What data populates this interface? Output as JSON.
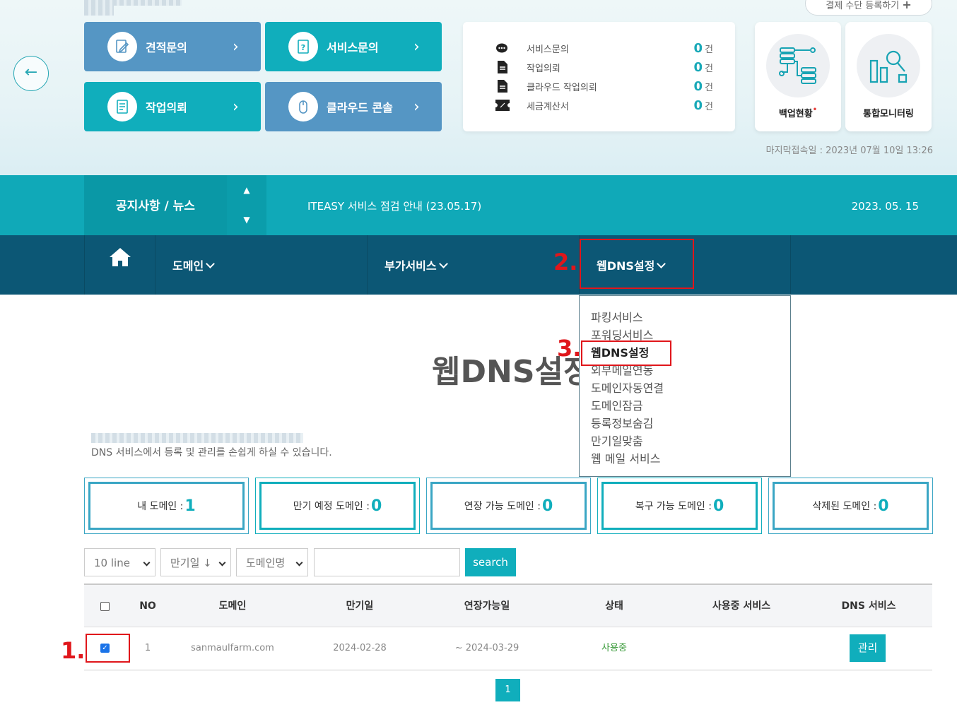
{
  "header": {
    "pay_register": "결제 수단 등록하기",
    "pay_plus": "+",
    "back_arrow": "←",
    "quick_buttons": [
      {
        "label": "견적문의",
        "icon": "edit-doc-icon",
        "color": "#5596c4"
      },
      {
        "label": "서비스문의",
        "icon": "question-doc-icon",
        "color": "#10aebc"
      },
      {
        "label": "작업의뢰",
        "icon": "list-doc-icon",
        "color": "#10aebc"
      },
      {
        "label": "클라우드 콘솔",
        "icon": "mouse-icon",
        "color": "#5596c4"
      }
    ],
    "chevron": "›",
    "stats": [
      {
        "label": "서비스문의",
        "value": "0",
        "unit": "건",
        "icon": "chat-icon"
      },
      {
        "label": "작업의뢰",
        "value": "0",
        "unit": "건",
        "icon": "document-icon"
      },
      {
        "label": "클라우드 작업의뢰",
        "value": "0",
        "unit": "건",
        "icon": "document-icon"
      },
      {
        "label": "세금계산서",
        "value": "0",
        "unit": "건",
        "icon": "ticket-icon"
      }
    ],
    "cards": [
      {
        "label": "백업현황",
        "dot": "•",
        "icon": "server-backup-icon"
      },
      {
        "label": "통합모니터링",
        "icon": "monitoring-chart-icon"
      }
    ],
    "last_login": "마지막접속일 : 2023년 07월 10일 13:26"
  },
  "notice": {
    "label": "공지사항 / 뉴스",
    "up": "▲",
    "down": "▼",
    "text": "ITEASY 서비스 점검 안내 (23.05.17)",
    "date": "2023. 05. 15"
  },
  "nav": {
    "home_icon": "home-icon",
    "domain": "도메인",
    "extra": "부가서비스",
    "dns": "웹DNS설정"
  },
  "dropdown": {
    "items": [
      "파킹서비스",
      "포워딩서비스",
      "웹DNS설정",
      "외부메일연동",
      "도메인자동연결",
      "도메인잠금",
      "등록정보숨김",
      "만기일맞춤",
      "웹 메일 서비스"
    ]
  },
  "annotations": {
    "a1": "1.",
    "a2": "2.",
    "a3": "3."
  },
  "page": {
    "title": "웹DNS설정",
    "description": "DNS 서비스에서 등록 및 관리를 손쉽게 하실 수 있습니다."
  },
  "summary": [
    {
      "label": "내 도메인 : ",
      "value": "1"
    },
    {
      "label": "만기 예정 도메인 : ",
      "value": "0"
    },
    {
      "label": "연장 가능 도메인 : ",
      "value": "0"
    },
    {
      "label": "복구 가능 도메인 : ",
      "value": "0"
    },
    {
      "label": "삭제된 도메인 : ",
      "value": "0"
    }
  ],
  "filters": {
    "lines": "10 line",
    "sort": "만기일 ↓",
    "field": "도메인명",
    "search_value": "",
    "search_button": "search"
  },
  "table": {
    "headers": [
      "NO",
      "도메인",
      "만기일",
      "연장가능일",
      "상태",
      "사용중 서비스",
      "DNS 서비스"
    ],
    "rows": [
      {
        "no": "1",
        "domain": "sanmaulfarm.com",
        "expiry": "2024-02-28",
        "renewable": "~ 2024-03-29",
        "status": "사용중",
        "services": "",
        "action": "관리",
        "checked": true
      }
    ]
  },
  "pagination": {
    "current": "1"
  }
}
